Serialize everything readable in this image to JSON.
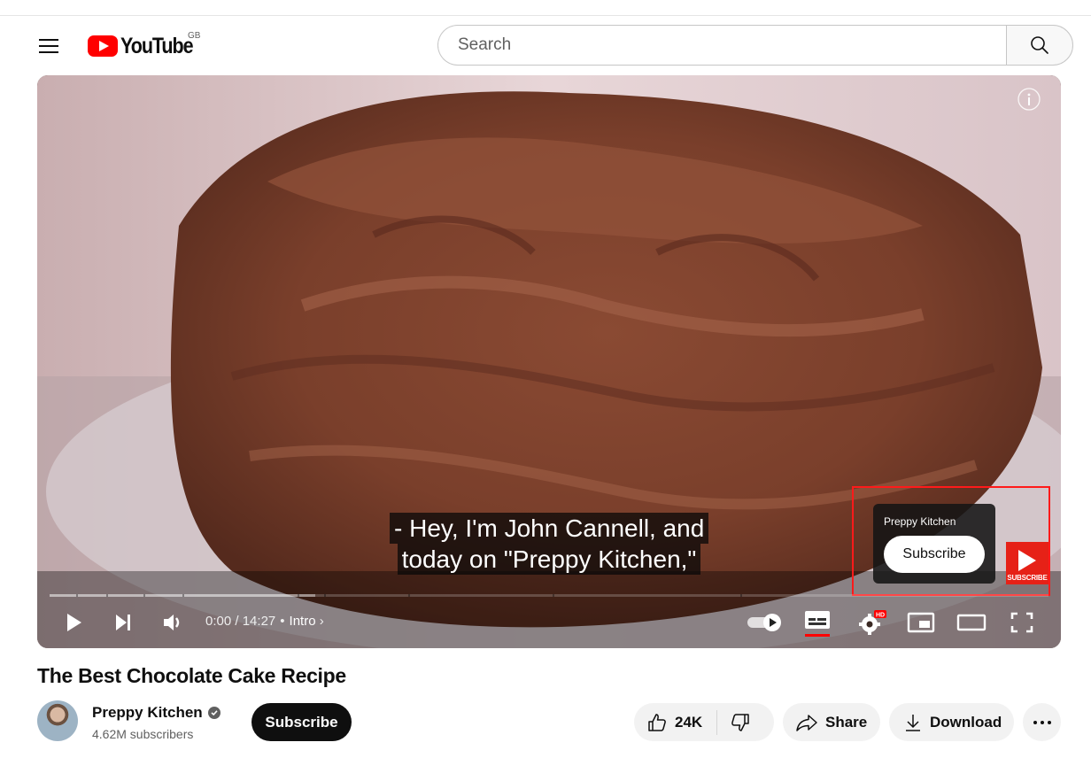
{
  "masthead": {
    "logo_text": "YouTube",
    "country_code": "GB",
    "search_placeholder": "Search"
  },
  "player": {
    "caption_line1": "- Hey, I'm John Cannell, and",
    "caption_line2": "today on \"Preppy Kitchen,\"",
    "endscreen_channel": "Preppy Kitchen",
    "endscreen_subscribe_label": "Subscribe",
    "watermark_label": "SUBSCRIBE",
    "time_current": "0:00",
    "time_total": "14:27",
    "chapter": "Intro",
    "progress_fraction": 0.0,
    "quality_badge": "HD"
  },
  "video": {
    "title": "The Best Chocolate Cake Recipe",
    "channel_name": "Preppy Kitchen",
    "subscribers": "4.62M subscribers",
    "subscribe_label": "Subscribe",
    "likes": "24K",
    "share_label": "Share",
    "download_label": "Download"
  },
  "colors": {
    "brand_red": "#ff0000",
    "text_primary": "#0f0f0f",
    "text_secondary": "#606060",
    "pill_bg": "#f2f2f2"
  }
}
